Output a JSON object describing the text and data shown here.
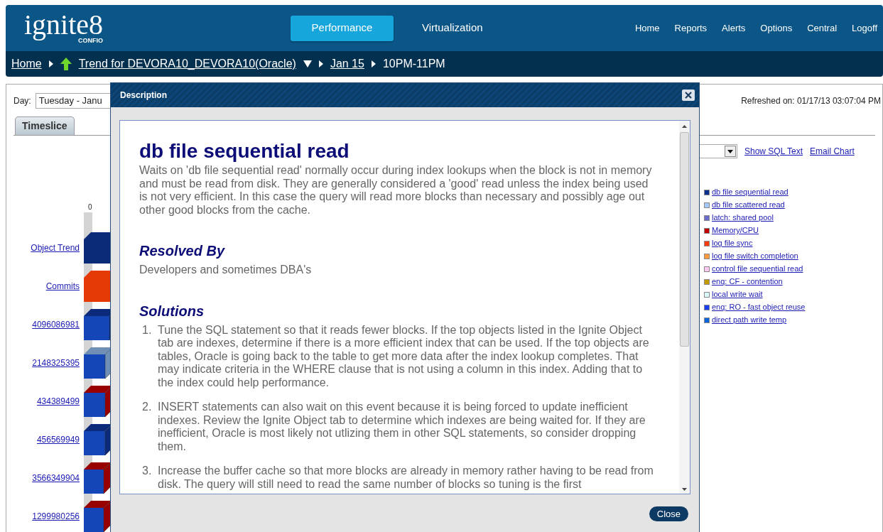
{
  "logo": {
    "name": "ignite8",
    "sub": "CONFIO"
  },
  "product_tabs": [
    {
      "label": "Performance",
      "selected": true
    },
    {
      "label": "Virtualization",
      "selected": false
    }
  ],
  "top_links": [
    "Home",
    "Reports",
    "Alerts",
    "Options",
    "Central",
    "Logoff"
  ],
  "breadcrumb": [
    {
      "label": "Home",
      "kind": "link"
    },
    {
      "label": "Trend for DEVORA10_DEVORA10(Oracle)",
      "kind": "trend"
    },
    {
      "label": "Jan 15",
      "kind": "link"
    },
    {
      "label": "10PM-11PM",
      "kind": "current"
    }
  ],
  "day": {
    "label": "Day:",
    "value": "Tuesday - Janu"
  },
  "view_tabs": [
    {
      "label": "Timeslice",
      "selected": false
    }
  ],
  "refreshed": "Refreshed on: 01/17/13 03:07:04 PM",
  "chart_links": [
    "Show SQL Text",
    "Email Chart"
  ],
  "legend": [
    {
      "label": "db file sequential read",
      "color": "#0b2f8a"
    },
    {
      "label": "db file scattered read",
      "color": "#a3c8f5"
    },
    {
      "label": "latch: shared pool",
      "color": "#6b6bc8"
    },
    {
      "label": "Memory/CPU",
      "color": "#c00000"
    },
    {
      "label": "log file sync",
      "color": "#ff3b0f"
    },
    {
      "label": "log file switch completion",
      "color": "#ff9a3c"
    },
    {
      "label": "control file sequential read",
      "color": "#ffc8f0"
    },
    {
      "label": "enq: CF - contention",
      "color": "#c49a00"
    },
    {
      "label": "local write wait",
      "color": "#dcfafa"
    },
    {
      "label": "enq: RO - fast object reuse",
      "color": "#1a3cf0"
    },
    {
      "label": "direct path write temp",
      "color": "#0a64dc"
    }
  ],
  "chart": {
    "axis_label": "0",
    "rows": [
      "Object Trend",
      "Commits",
      "4096086981",
      "2148325395",
      "434389499",
      "456569949",
      "3566349904",
      "1299980256"
    ]
  },
  "dialog": {
    "title": "Description",
    "heading": "db file sequential read",
    "intro": "Waits on 'db file sequential read' normally occur during index lookups when the block is not in memory and must be read from disk. They are generally considered a 'good' read unless the index being used is not very efficient. In this case the query will read more blocks than necessary and possibly age out other good blocks from the cache.",
    "sections": [
      {
        "heading": "Resolved By",
        "kind": "text",
        "text": "Developers and sometimes DBA's"
      },
      {
        "heading": "Solutions",
        "kind": "list",
        "items": [
          {
            "number": "1.",
            "text": "Tune the SQL statement so that it reads fewer blocks. If the top objects listed in the Ignite Object tab are indexes, determine if there is a more efficient index that can be used. If the top objects are tables, Oracle is going back to the table to get more data after the index lookup completes. That may indicate criteria in the WHERE clause that is not using a column in this index. Adding that to the index could help performance."
          },
          {
            "number": "2.",
            "text": "INSERT statements can also wait on this event because it is being forced to update inefficient indexes. Review the Ignite Object tab to determine which indexes are being waited for. If they are inefficient, Oracle is most likely not utlizing them in other SQL statements, so consider dropping them."
          },
          {
            "number": "3.",
            "text": "Increase the buffer cache so that more blocks are already in memory rather having to be read from disk. The query will still need to read the same number of blocks so tuning is the first"
          }
        ]
      }
    ],
    "close_button": "Close"
  }
}
